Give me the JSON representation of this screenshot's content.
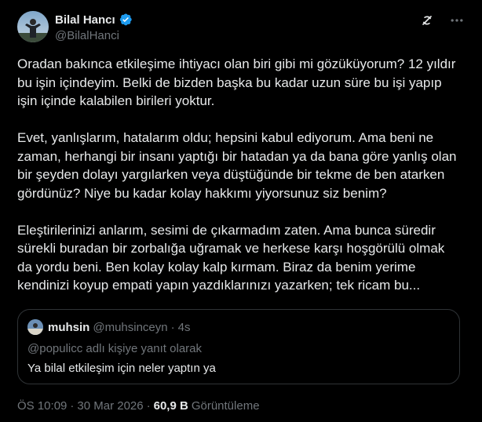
{
  "author": {
    "display_name": "Bilal Hancı",
    "handle": "@BilalHanci",
    "verified_color": "#1d9bf0"
  },
  "icons": {
    "verified": "verified-badge-icon",
    "grok": "grok-icon",
    "more": "more-options-icon"
  },
  "tweet": {
    "paragraphs": [
      "Oradan bakınca etkileşime ihtiyacı olan biri gibi mi gözüküyorum? 12 yıldır bu işin içindeyim. Belki de bizden başka bu kadar uzun süre bu işi yapıp işin içinde kalabilen birileri yoktur.",
      "Evet, yanlışlarım, hatalarım oldu; hepsini kabul ediyorum. Ama beni ne zaman, herhangi bir insanı yaptığı bir hatadan ya da bana göre yanlış olan bir şeyden dolayı yargılarken veya düştüğünde bir tekme de ben atarken gördünüz? Niye bu kadar kolay hakkımı yiyorsunuz siz benim?",
      "Eleştirilerinizi anlarım, sesimi de çıkarmadım zaten. Ama bunca süredir sürekli buradan bir zorbalığa uğramak ve herkese karşı hoşgörülü olmak da yordu beni. Ben kolay kolay kalp kırmam. Biraz da benim yerime kendinizi koyup empati yapın yazdıklarınızı yazarken; tek ricam bu..."
    ]
  },
  "quoted": {
    "name": "muhsin",
    "handle": "@muhsinceyn",
    "dot": "·",
    "time": "4s",
    "reply_to": "@populicc adlı kişiye yanıt olarak",
    "text": "Ya bilal etkileşim için neler yaptın ya"
  },
  "footer": {
    "time": "ÖS 10:09",
    "sep": "·",
    "date": "30 Mar 2026",
    "views_count": "60,9 B",
    "views_label": "Görüntüleme"
  }
}
